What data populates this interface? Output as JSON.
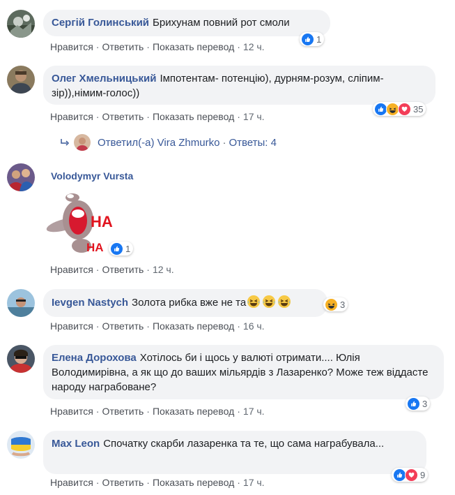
{
  "actions": {
    "like": "Нравится",
    "reply": "Ответить",
    "translate": "Показать перевод",
    "sep": "·"
  },
  "colors": {
    "like": "#1877f2",
    "haha": "#f7b125",
    "love": "#f33e58",
    "name": "#385898"
  },
  "comments": [
    {
      "author": "Сергій Голинський",
      "text": "Брихунам повний рот смоли",
      "time": "12 ч.",
      "reactions": [
        "like-icon"
      ],
      "reaction_count": "1"
    },
    {
      "author": "Олег Хмельницький",
      "text": "Імпотентам- потенцію), дурням-розум, сліпим-зір)),німим-голос))",
      "time": "17 ч.",
      "reactions": [
        "like-icon",
        "haha-icon",
        "love-icon"
      ],
      "reaction_count": "35",
      "replies": {
        "label": "Ответил(-а) Vira Zhmurko",
        "count_label": "Ответы: 4"
      }
    },
    {
      "author": "Volodymyr Vursta",
      "text": "",
      "sticker": "haha-sticker",
      "sticker_text": "HA",
      "sticker_text2": "HA",
      "time": "12 ч.",
      "reactions": [
        "like-icon"
      ],
      "reaction_count": "1"
    },
    {
      "author": "Ievgen Nastych",
      "text": "Золота рибка вже не та",
      "emoji": [
        "laughing-emoji",
        "laughing-emoji",
        "laughing-emoji"
      ],
      "time": "16 ч.",
      "reactions": [
        "haha-icon"
      ],
      "reaction_count": "3"
    },
    {
      "author": "Елена Дорохова",
      "text": "Хотілось би і щось у валюті отримати.... Юлія Володимирівна, а як що до ваших мільярдів з Лазаренко? Може теж віддасте народу награбоване?",
      "time": "17 ч.",
      "reactions": [
        "like-icon"
      ],
      "reaction_count": "3"
    },
    {
      "author": "Max Leon",
      "text": "Спочатку скарби лазаренка та те, що сама награбувала...",
      "time": "17 ч.",
      "reactions": [
        "like-icon",
        "love-icon"
      ],
      "reaction_count": "9"
    }
  ]
}
